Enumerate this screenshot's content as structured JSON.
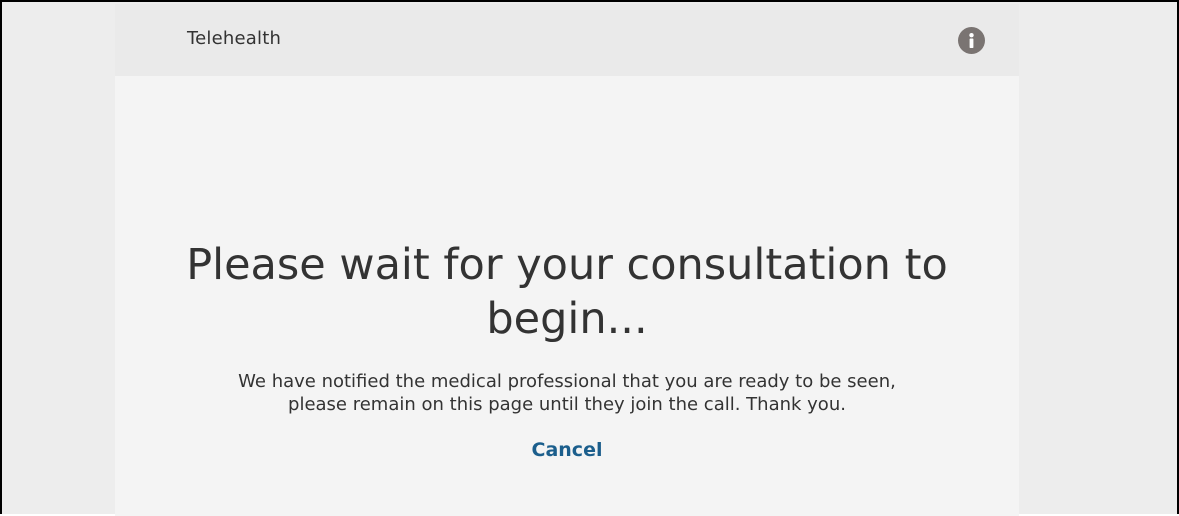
{
  "header": {
    "title": "Telehealth",
    "info_icon": "info-icon"
  },
  "main": {
    "headline_line1": "Please wait for your consultation to",
    "headline_line2": "begin...",
    "message_line1": "We have notified the medical professional that you are ready to be seen,",
    "message_line2": "please remain on this page until they join the call. Thank you.",
    "cancel_label": "Cancel"
  },
  "colors": {
    "page_bg": "#ededed",
    "panel_bg": "#f4f4f4",
    "header_bg": "#eaeaea",
    "text": "#333333",
    "link": "#1b5e8c",
    "info_icon_bg": "#7a7472"
  }
}
